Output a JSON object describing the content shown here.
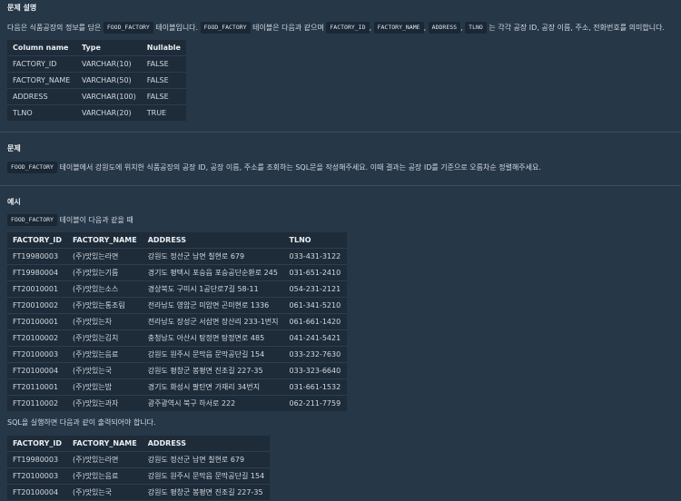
{
  "desc": {
    "heading": "문제 설명",
    "t1": "다음은 식품공장의 정보를 담은",
    "c1": "FOOD_FACTORY",
    "t2": "테이블입니다.",
    "c2": "FOOD_FACTORY",
    "t3": "테이블은 다음과 같으며",
    "c3": "FACTORY_ID",
    "c4": "FACTORY_NAME",
    "c5": "ADDRESS",
    "c6": "TLNO",
    "t4": "는 각각 공장 ID, 공장 이름, 주소, 전화번호를 의미합니다.",
    "comma": ","
  },
  "schema": {
    "headers": [
      "Column name",
      "Type",
      "Nullable"
    ],
    "rows": [
      [
        "FACTORY_ID",
        "VARCHAR(10)",
        "FALSE"
      ],
      [
        "FACTORY_NAME",
        "VARCHAR(50)",
        "FALSE"
      ],
      [
        "ADDRESS",
        "VARCHAR(100)",
        "FALSE"
      ],
      [
        "TLNO",
        "VARCHAR(20)",
        "TRUE"
      ]
    ]
  },
  "problem": {
    "heading": "문제",
    "c1": "FOOD_FACTORY",
    "text": "테이블에서 강원도에 위치한 식품공장의 공장 ID, 공장 이름, 주소를 조회하는 SQL문을 작성해주세요. 이때 결과는 공장 ID를 기준으로 오름차순 정렬해주세요."
  },
  "example": {
    "heading": "예시",
    "c1": "FOOD_FACTORY",
    "text": "테이블이 다음과 같을 때",
    "headers": [
      "FACTORY_ID",
      "FACTORY_NAME",
      "ADDRESS",
      "TLNO"
    ],
    "rows": [
      [
        "FT19980003",
        "(주)맛있는라면",
        "강원도 정선군 남면 칠현로 679",
        "033-431-3122"
      ],
      [
        "FT19980004",
        "(주)맛있는기름",
        "경기도 평택시 포승읍 포승공단순환로 245",
        "031-651-2410"
      ],
      [
        "FT20010001",
        "(주)맛있는소스",
        "경상북도 구미시 1공단로7길 58-11",
        "054-231-2121"
      ],
      [
        "FT20010002",
        "(주)맛있는통조림",
        "전라남도 영암군 미암면 곤미현로 1336",
        "061-341-5210"
      ],
      [
        "FT20100001",
        "(주)맛있는차",
        "전라남도 장성군 서삼면 장산리 233-1번지",
        "061-661-1420"
      ],
      [
        "FT20100002",
        "(주)맛있는김치",
        "충청남도 아산시 탕정면 탕정면로 485",
        "041-241-5421"
      ],
      [
        "FT20100003",
        "(주)맛있는음료",
        "강원도 원주시 문막읍 문막공단길 154",
        "033-232-7630"
      ],
      [
        "FT20100004",
        "(주)맛있는국",
        "강원도 평창군 봉평면 진조길 227-35",
        "033-323-6640"
      ],
      [
        "FT20110001",
        "(주)맛있는밥",
        "경기도 화성시 팔탄면 가재리 34번지",
        "031-661-1532"
      ],
      [
        "FT20110002",
        "(주)맛있는과자",
        "광주광역시 북구 하서로 222",
        "062-211-7759"
      ]
    ]
  },
  "result": {
    "text": "SQL을 실행하면 다음과 같이 출력되어야 합니다.",
    "headers": [
      "FACTORY_ID",
      "FACTORY_NAME",
      "ADDRESS"
    ],
    "rows": [
      [
        "FT19980003",
        "(주)맛있는라면",
        "강원도 정선군 남면 칠현로 679"
      ],
      [
        "FT20100003",
        "(주)맛있는음료",
        "강원도 원주시 문막읍 문막공단길 154"
      ],
      [
        "FT20100004",
        "(주)맛있는국",
        "강원도 평창군 봉평면 진조길 227-35"
      ]
    ]
  }
}
